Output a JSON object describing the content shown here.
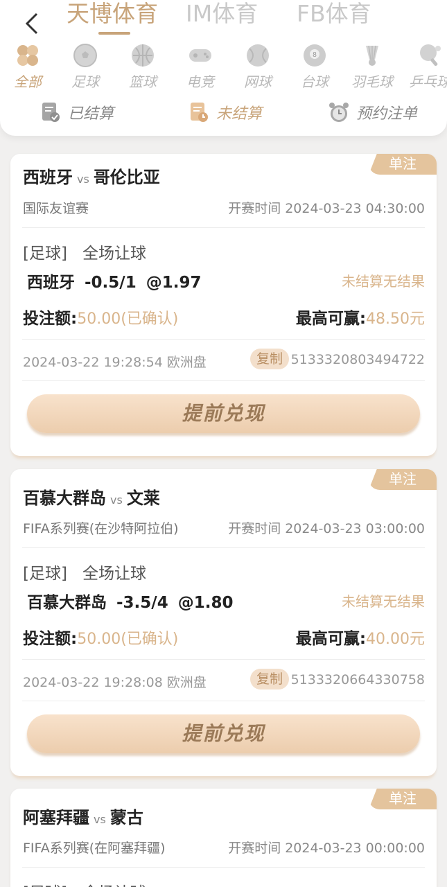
{
  "header": {
    "tabs": [
      {
        "label": "天博体育",
        "active": true
      },
      {
        "label": "IM体育",
        "active": false
      },
      {
        "label": "FB体育",
        "active": false
      }
    ],
    "categories": [
      {
        "label": "全部",
        "icon": "all-grid-icon",
        "active": true
      },
      {
        "label": "足球",
        "icon": "soccer-ball-icon"
      },
      {
        "label": "篮球",
        "icon": "basketball-icon"
      },
      {
        "label": "电竞",
        "icon": "gamepad-icon"
      },
      {
        "label": "网球",
        "icon": "tennis-ball-icon"
      },
      {
        "label": "台球",
        "icon": "billiard-ball-icon"
      },
      {
        "label": "羽毛球",
        "icon": "shuttlecock-icon"
      },
      {
        "label": "乒乓球",
        "icon": "ping-pong-icon"
      }
    ],
    "status_tabs": [
      {
        "label": "已结算",
        "icon": "settled-doc-icon"
      },
      {
        "label": "未结算",
        "icon": "unsettled-doc-icon",
        "active": true
      },
      {
        "label": "预约注单",
        "icon": "alarm-clock-icon"
      }
    ]
  },
  "common": {
    "badge": "单注",
    "vs": "vs",
    "start_label": "开赛时间",
    "sport": "[足球]",
    "market": "全场让球",
    "pending": "未结算无结果",
    "bet_label": "投注额:",
    "confirmed": "(已确认)",
    "max_win_label": "最高可赢:",
    "copy": "复制",
    "odds_type": "欧洲盘",
    "cashout": "提前兑现"
  },
  "bets": [
    {
      "home": "西班牙",
      "away": "哥伦比亚",
      "league": "国际友谊赛",
      "start_time": "2024-03-23 04:30:00",
      "pick_team": "西班牙",
      "handicap": "-0.5/1",
      "odds": "@1.97",
      "stake": "50.00",
      "max_win": "48.50元",
      "placed_at": "2024-03-22 19:28:54",
      "order_no": "5133320803494722"
    },
    {
      "home": "百慕大群岛",
      "away": "文莱",
      "league": "FIFA系列赛(在沙特阿拉伯)",
      "start_time": "2024-03-23 03:00:00",
      "pick_team": "百慕大群岛",
      "handicap": "-3.5/4",
      "odds": "@1.80",
      "stake": "50.00",
      "max_win": "40.00元",
      "placed_at": "2024-03-22 19:28:08",
      "order_no": "5133320664330758"
    },
    {
      "home": "阿塞拜疆",
      "away": "蒙古",
      "league": "FIFA系列赛(在阿塞拜疆)",
      "start_time": "2024-03-23 00:00:00",
      "pick_team": "",
      "handicap": "",
      "odds": "",
      "stake": "",
      "max_win": "",
      "placed_at": "",
      "order_no": ""
    }
  ],
  "colors": {
    "accent": "#c8a47a",
    "badge": "#e4c49d",
    "amount": "#d9b58c"
  }
}
